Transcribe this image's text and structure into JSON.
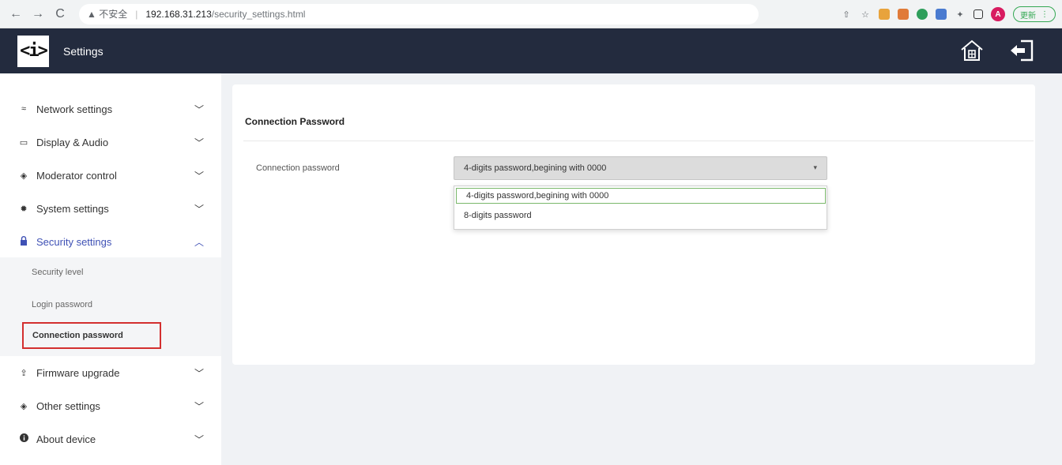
{
  "browser": {
    "security_warning": "▲ 不安全",
    "url_host": "192.168.31.213",
    "url_path": "/security_settings.html",
    "update_label": "更新",
    "avatar_letter": "A"
  },
  "header": {
    "logo_text": "<i>",
    "title": "Settings"
  },
  "sidebar": {
    "items": [
      {
        "label": "Network settings",
        "icon": "wifi-icon",
        "glyph": "≈"
      },
      {
        "label": "Display & Audio",
        "icon": "monitor-icon",
        "glyph": "▭"
      },
      {
        "label": "Moderator control",
        "icon": "diamond-icon",
        "glyph": "◈"
      },
      {
        "label": "System settings",
        "icon": "gear-icon",
        "glyph": "✹"
      },
      {
        "label": "Security settings",
        "icon": "lock-icon",
        "glyph": "🔒"
      },
      {
        "label": "Firmware upgrade",
        "icon": "upload-icon",
        "glyph": "⇪"
      },
      {
        "label": "Other settings",
        "icon": "diamond-icon",
        "glyph": "◈"
      },
      {
        "label": "About device",
        "icon": "info-icon",
        "glyph": "ℹ"
      }
    ],
    "security_submenu": [
      {
        "label": "Security level"
      },
      {
        "label": "Login password"
      },
      {
        "label": "Connection password"
      }
    ],
    "expanded_item": "Security settings",
    "selected_sub_item": "Connection password",
    "accent_color": "#3f51b5",
    "highlight_color": "#d32f2f"
  },
  "main": {
    "card_title": "Connection Password",
    "field_label": "Connection password",
    "select_value": "4-digits password,begining with 0000",
    "options": [
      "4-digits password,begining with 0000",
      "8-digits password"
    ]
  }
}
